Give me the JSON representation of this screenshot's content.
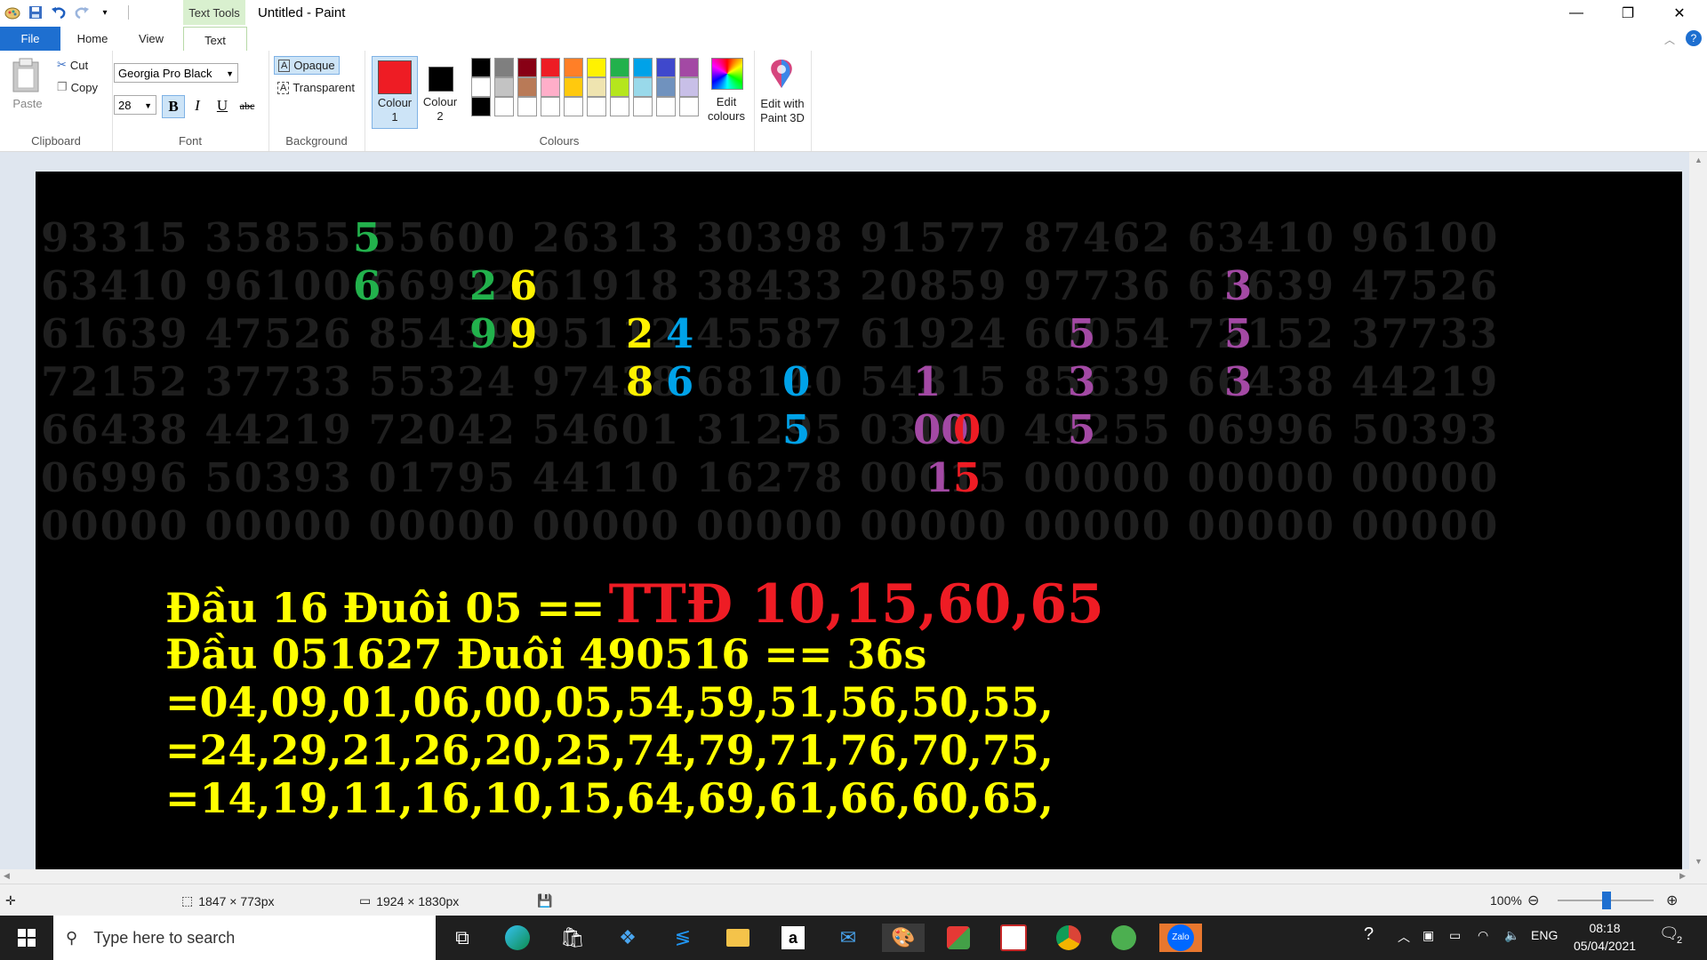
{
  "window": {
    "title": "Untitled - Paint",
    "contextual_tab": "Text Tools",
    "controls": {
      "minimize": "—",
      "maximize": "❐",
      "close": "✕"
    }
  },
  "tabs": [
    {
      "label": "File"
    },
    {
      "label": "Home"
    },
    {
      "label": "View"
    },
    {
      "label": "Text"
    }
  ],
  "ribbon": {
    "clipboard": {
      "paste": "Paste",
      "cut": "Cut",
      "copy": "Copy",
      "label": "Clipboard"
    },
    "font": {
      "name": "Georgia Pro Black",
      "size": "28",
      "bold": "B",
      "italic": "I",
      "underline": "U",
      "strike": "abc",
      "label": "Font"
    },
    "background": {
      "opaque": "Opaque",
      "transparent": "Transparent",
      "label": "Background"
    },
    "colours": {
      "colour1_line1": "Colour",
      "colour1_line2": "1",
      "colour2_line1": "Colour",
      "colour2_line2": "2",
      "edit_line1": "Edit",
      "edit_line2": "colours",
      "label": "Colours",
      "colour1": "#ee1c24",
      "colour2": "#000000",
      "palette_row1": [
        "#000000",
        "#7f7f7f",
        "#880015",
        "#ed1c24",
        "#ff7f27",
        "#fff200",
        "#22b14c",
        "#00a2e8",
        "#3f48cc",
        "#a349a4"
      ],
      "palette_row2": [
        "#ffffff",
        "#c3c3c3",
        "#b97a57",
        "#ffaec9",
        "#ffc90e",
        "#efe4b0",
        "#b5e61d",
        "#99d9ea",
        "#7092be",
        "#c8bfe7"
      ],
      "palette_row3": [
        "#000000",
        "#ffffff",
        "#ffffff",
        "#ffffff",
        "#ffffff",
        "#ffffff",
        "#ffffff",
        "#ffffff",
        "#ffffff",
        "#ffffff"
      ]
    },
    "paint3d": {
      "line1": "Edit with",
      "line2": "Paint 3D"
    }
  },
  "canvas": {
    "bg_rows": [
      "93315 35855 55600 26313 30398 91577 87462 63410 96100",
      "63410 96100 66992 61918 38433 20859 97736 61639 47526",
      "61639 47526 85439 95112 45587 61924 60054 72152 37733",
      "72152 37733 55324 97438 68140 54315 85639 66438 44219",
      "66438 44219 72042 54601 31295 03000 49255 06996 50393",
      "06996 50393 01795 44110 16278 00015 00000 00000 00000",
      "00000 00000 00000 00000 00000 00000 00000 00000 00000"
    ],
    "highlights": [
      {
        "text": "5",
        "color": "#22b14c"
      },
      {
        "text": "6",
        "color": "#22b14c"
      },
      {
        "text": "2",
        "color": "#22b14c"
      },
      {
        "text": "6",
        "color": "#fff200"
      },
      {
        "text": "3",
        "color": "#a349a4"
      },
      {
        "text": "9",
        "color": "#22b14c"
      },
      {
        "text": "9",
        "color": "#fff200"
      },
      {
        "text": "2",
        "color": "#fff200"
      },
      {
        "text": "4",
        "color": "#00a2e8"
      },
      {
        "text": "5",
        "color": "#a349a4"
      },
      {
        "text": "5",
        "color": "#a349a4"
      },
      {
        "text": "8",
        "color": "#fff200"
      },
      {
        "text": "6",
        "color": "#00a2e8"
      },
      {
        "text": "0",
        "color": "#00a2e8"
      },
      {
        "text": "1",
        "color": "#a349a4"
      },
      {
        "text": "3",
        "color": "#a349a4"
      },
      {
        "text": "3",
        "color": "#a349a4"
      },
      {
        "text": "5",
        "color": "#00a2e8"
      },
      {
        "text": "00",
        "color": "#a349a4"
      },
      {
        "text": "0",
        "color": "#ee1c24"
      },
      {
        "text": "5",
        "color": "#a349a4"
      },
      {
        "text": "1",
        "color": "#a349a4"
      },
      {
        "text": "5",
        "color": "#ee1c24"
      }
    ],
    "message": {
      "line1_yellow": "Đầu 16 Đuôi 05 ==",
      "line1_red": "TTĐ 10,15,60,65",
      "line2": "Đầu 051627 Đuôi 490516 == 36s",
      "line3": "=04,09,01,06,00,05,54,59,51,56,50,55,",
      "line4": "=24,29,21,26,20,25,74,79,71,76,70,75,",
      "line5": "=14,19,11,16,10,15,64,69,61,66,60,65,"
    }
  },
  "status": {
    "selection": "1847 × 773px",
    "image_size": "1924 × 1830px",
    "zoom": "100%"
  },
  "taskbar": {
    "search_placeholder": "Type here to search",
    "lang": "ENG",
    "time": "08:18",
    "date": "05/04/2021",
    "notif_count": "2"
  }
}
